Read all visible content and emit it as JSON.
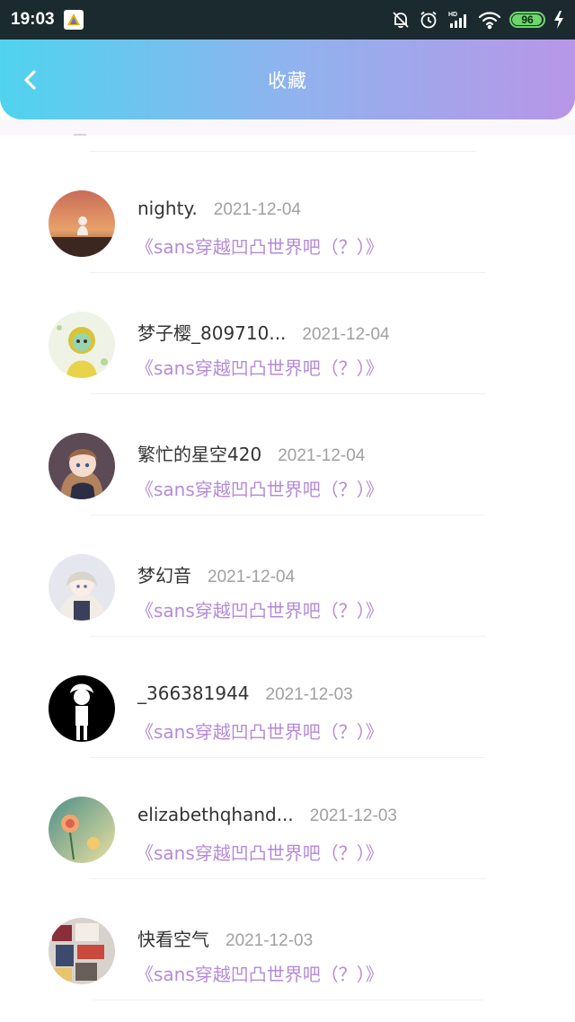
{
  "status_bar": {
    "time": "19:03",
    "battery": "96",
    "icons": [
      "app-icon",
      "bell-muted-icon",
      "alarm-icon",
      "hd-signal-icon",
      "wifi-icon",
      "battery-icon",
      "charging-bolt-icon"
    ]
  },
  "header": {
    "title": "收藏",
    "back_icon": "chevron-left-icon",
    "gradient": [
      "#4fd3ef",
      "#b896e8"
    ]
  },
  "items": [
    {
      "username": "nighty.",
      "date": "2021-12-04",
      "book": "《sans穿越凹凸世界吧（？）》"
    },
    {
      "username": "梦子樱_809710...",
      "date": "2021-12-04",
      "book": "《sans穿越凹凸世界吧（？）》"
    },
    {
      "username": "繁忙的星空420",
      "date": "2021-12-04",
      "book": "《sans穿越凹凸世界吧（？）》"
    },
    {
      "username": "梦幻音",
      "date": "2021-12-04",
      "book": "《sans穿越凹凸世界吧（？）》"
    },
    {
      "username": "_366381944",
      "date": "2021-12-03",
      "book": "《sans穿越凹凸世界吧（？）》"
    },
    {
      "username": "elizabethqhand...",
      "date": "2021-12-03",
      "book": "《sans穿越凹凸世界吧（？）》"
    },
    {
      "username": "快看空气",
      "date": "2021-12-03",
      "book": "《sans穿越凹凸世界吧（？）》"
    }
  ],
  "colors": {
    "book_title": "#b58ad8",
    "date": "#a0a0a0",
    "username": "#333333"
  }
}
